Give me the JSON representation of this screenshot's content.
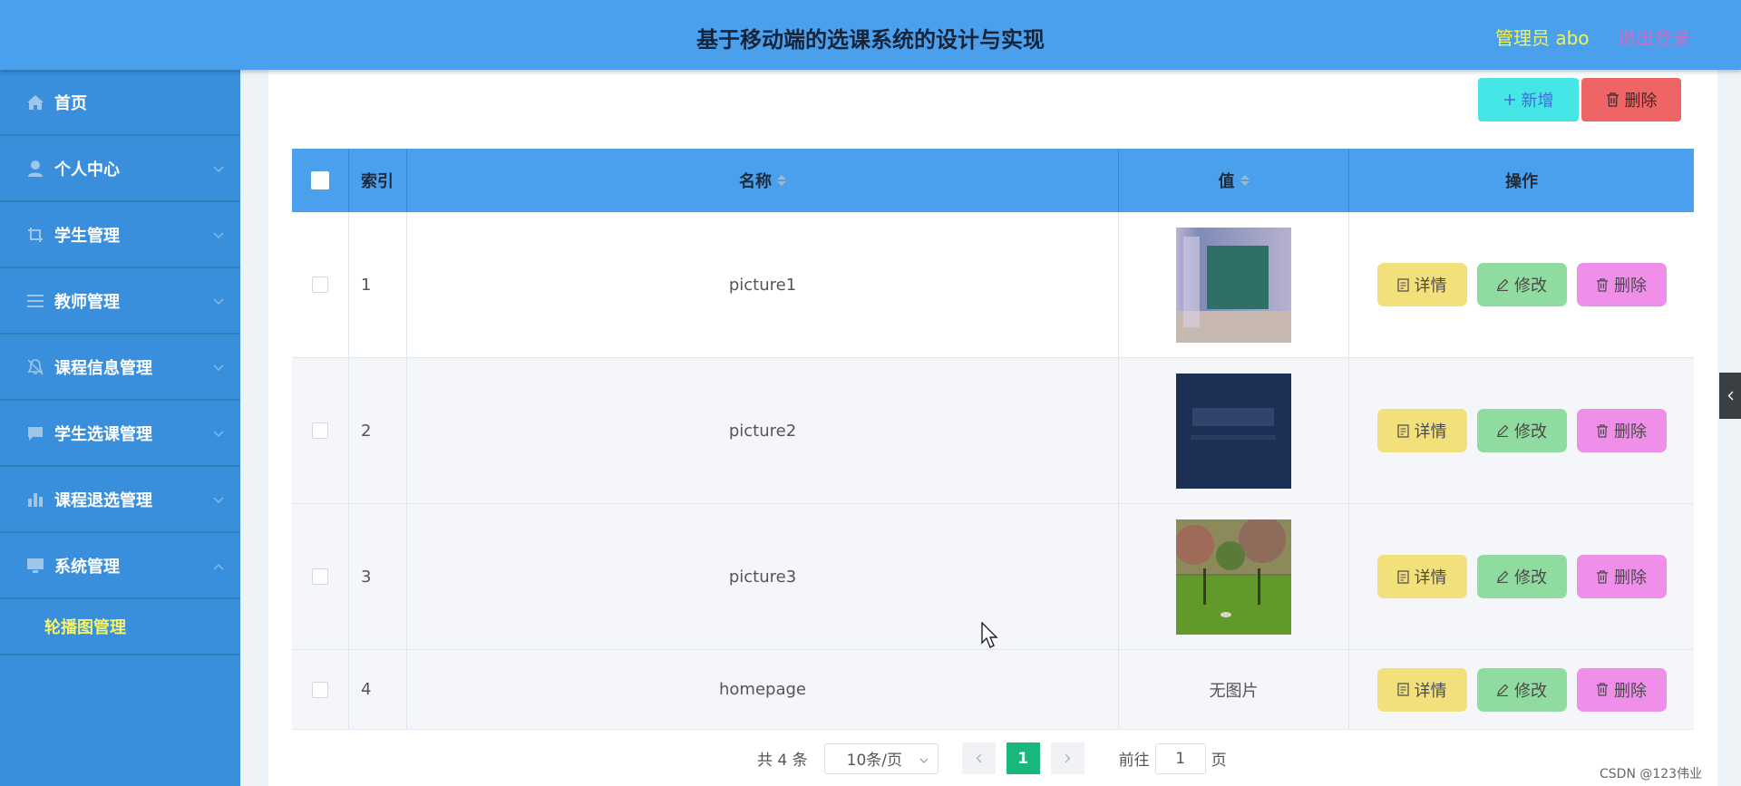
{
  "header": {
    "title": "基于移动端的选课系统的设计与实现",
    "admin": "管理员 abo",
    "logout": "退出登录"
  },
  "sidebar": {
    "items": [
      {
        "label": "首页",
        "icon": "home-icon"
      },
      {
        "label": "个人中心",
        "icon": "user-icon"
      },
      {
        "label": "学生管理",
        "icon": "crop-icon"
      },
      {
        "label": "教师管理",
        "icon": "list-icon"
      },
      {
        "label": "课程信息管理",
        "icon": "bell-icon"
      },
      {
        "label": "学生选课管理",
        "icon": "message-icon"
      },
      {
        "label": "课程退选管理",
        "icon": "bar-chart-icon"
      },
      {
        "label": "系统管理",
        "icon": "monitor-icon"
      }
    ],
    "submenu": {
      "label": "轮播图管理"
    }
  },
  "toolbar": {
    "add_label": "新增",
    "delete_label": "删除"
  },
  "table": {
    "headers": {
      "index": "索引",
      "name": "名称",
      "value": "值",
      "ops": "操作"
    },
    "rows": [
      {
        "index": "1",
        "name": "picture1",
        "value_image": "classroom-board"
      },
      {
        "index": "2",
        "name": "picture2",
        "value_image": "dark-blue-sign"
      },
      {
        "index": "3",
        "name": "picture3",
        "value_image": "campus-lawn"
      },
      {
        "index": "4",
        "name": "homepage",
        "value_text": "无图片"
      }
    ],
    "actions": {
      "detail": "详情",
      "edit": "修改",
      "remove": "删除"
    }
  },
  "pager": {
    "total": "共 4 条",
    "page_size": "10条/页",
    "current_page": "1",
    "goto_label": "前往",
    "goto_value": "1",
    "page_suffix": "页"
  },
  "watermark": "CSDN @123伟业",
  "colors": {
    "header": "#4aa0ec",
    "sidebar": "#3a8fdc",
    "add": "#47e6e6",
    "delete": "#ef6565",
    "detail": "#f2e07a",
    "edit": "#90dba0",
    "remove": "#ef8fea",
    "page_active": "#19b77b"
  }
}
